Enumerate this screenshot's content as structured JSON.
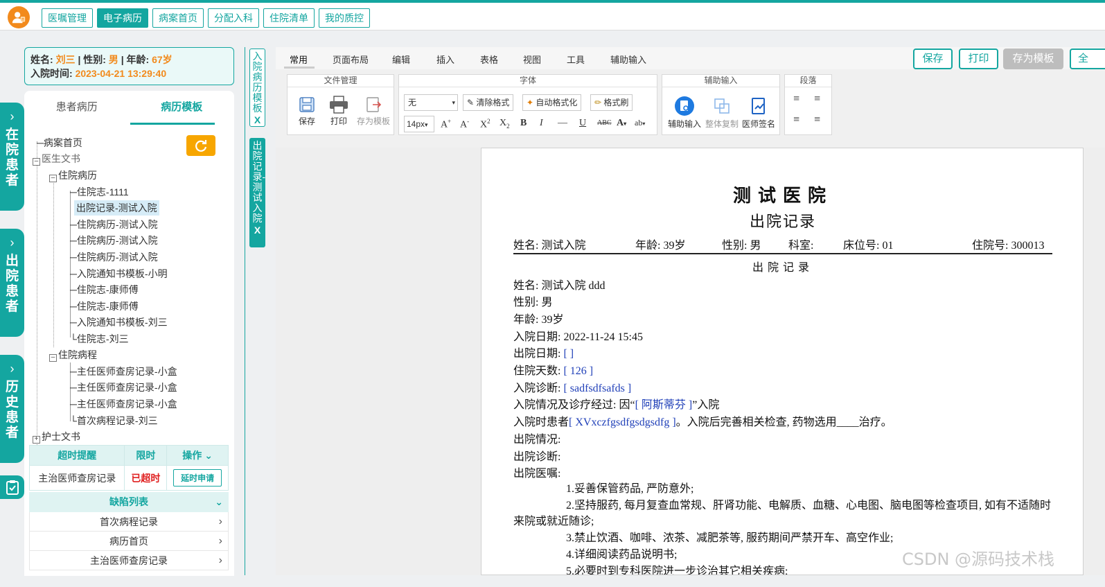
{
  "topnav": {
    "items": [
      {
        "label": "医嘱管理",
        "active": false
      },
      {
        "label": "电子病历",
        "active": true
      },
      {
        "label": "病案首页",
        "active": false
      },
      {
        "label": "分配入科",
        "active": false
      },
      {
        "label": "住院清单",
        "active": false
      },
      {
        "label": "我的质控",
        "active": false
      }
    ]
  },
  "side_tabs": [
    {
      "label": "在院患者"
    },
    {
      "label": "出院患者"
    },
    {
      "label": "历史患者"
    }
  ],
  "patient": {
    "name_label": "姓名:",
    "name": "刘三",
    "gender_label": "| 性别:",
    "gender": "男",
    "age_label": "| 年龄:",
    "age": "67岁",
    "admit_label": "入院时间:",
    "admit_time": "2023-04-21 13:29:40"
  },
  "left_tabs": {
    "patient_records": "患者病历",
    "templates": "病历模板"
  },
  "tree": {
    "root": "病案首页",
    "doctor_docs": "医生文书",
    "inpatient_records": "住院病历",
    "record_items": [
      "住院志-1111",
      "出院记录-测试入院",
      "住院病历-测试入院",
      "住院病历-测试入院",
      "住院病历-测试入院",
      "入院通知书模板-小明",
      "住院志-康师傅",
      "住院志-康师傅",
      "入院通知书模板-刘三",
      "住院志-刘三"
    ],
    "course": "住院病程",
    "course_items": [
      "主任医师查房记录-小盒",
      "主任医师查房记录-小盒",
      "主任医师查房记录-小盒",
      "首次病程记录-刘三"
    ],
    "nurse_docs": "护士文书"
  },
  "warn_table": {
    "headers": [
      "超时提醒",
      "限时",
      "操作"
    ],
    "row": {
      "name": "主治医师查房记录",
      "status": "已超时",
      "action": "延时申请"
    }
  },
  "defects": {
    "title": "缺陷列表",
    "items": [
      "首次病程记录",
      "病历首页",
      "主治医师查房记录"
    ]
  },
  "mid_tabs": {
    "tab1": "入院病历模板",
    "tab2": "出院记录-测试入院",
    "close": "X"
  },
  "menubar": [
    "常用",
    "页面布局",
    "编辑",
    "插入",
    "表格",
    "视图",
    "工具",
    "辅助输入"
  ],
  "actions": {
    "save": "保存",
    "print": "打印",
    "save_template": "存为模板",
    "more": "全"
  },
  "ribbon": {
    "file_group": "文件管理",
    "file_save": "保存",
    "file_print": "打印",
    "file_template": "存为模板",
    "font_group": "字体",
    "font_name": "无",
    "font_size": "14px",
    "clear_format": "清除格式",
    "auto_format": "自动格式化",
    "format_painter": "格式刷",
    "assist_group": "辅助输入",
    "assist_input": "辅助输入",
    "copy_all": "整体复制",
    "doctor_sign": "医师签名",
    "para_group": "段落"
  },
  "document": {
    "hospital": "测试医院",
    "title": "出院记录",
    "info": {
      "name": "姓名: 测试入院",
      "age": "年龄: 39岁",
      "gender": "性别: 男",
      "dept": "科室:",
      "bed": "床位号: 01",
      "inpatient_no": "住院号: 300013"
    },
    "subtitle": "出院记录",
    "lines": {
      "name": "姓名:  测试入院   ddd",
      "gender": "性别:  男",
      "age": "年龄:  39岁",
      "admit_date": "入院日期:  2022-11-24 15:45",
      "discharge_date_label": "出院日期:",
      "discharge_date_val": "[ ]",
      "days_label": "住院天数:",
      "days_val": "[ 126 ]",
      "admit_diag_label": "入院诊断:",
      "admit_diag_val": "[ sadfsdfsafds ]",
      "course_pre": "入院情况及诊疗经过: 因“",
      "course_val": "[ 阿斯蒂芬 ]",
      "course_post": "”入院",
      "admit_state_pre": "入院时患者",
      "admit_state_val": "[ XVxczfgsdfgsdgsdfg ]",
      "admit_state_post": "。入院后完善相关检查, 药物选用____治疗。",
      "discharge_state": "出院情况:",
      "discharge_diag": "出院诊断:",
      "discharge_orders": "出院医嘱:"
    },
    "orders": [
      "1.妥善保管药品, 严防意外;",
      "2.坚持服药, 每月复查血常规、肝肾功能、电解质、血糖、心电图、脑电图等检查项目, 如有不适随时来院或就近随诊;",
      "3.禁止饮酒、咖啡、浓茶、减肥茶等, 服药期间严禁开车、高空作业;",
      "4.详细阅读药品说明书;",
      "5.必要时到专科医院进一步诊治其它相关疾病;"
    ]
  },
  "watermark": "CSDN @源码技术栈",
  "colors": {
    "accent": "#14a6a0",
    "orange": "#f28a1c",
    "alert": "#e02020",
    "field": "#1f3fb8"
  }
}
